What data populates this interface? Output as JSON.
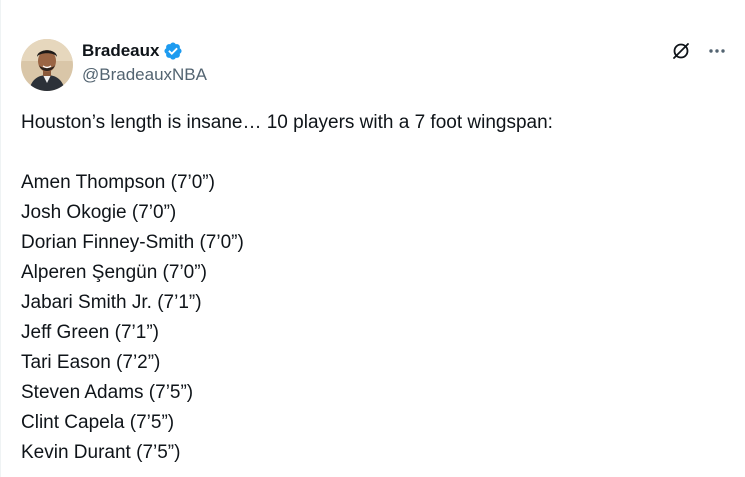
{
  "author": {
    "display_name": "Bradeaux",
    "handle": "@BradeauxNBA",
    "verified_badge_color": "#1d9bf0"
  },
  "actions": {
    "grok_icon": "grok-icon",
    "more_icon": "more-icon"
  },
  "tweet": {
    "intro": "Houston’s length is insane… 10 players with a 7 foot wingspan:",
    "players": [
      "Amen Thompson (7’0”)",
      "Josh Okogie (7’0”)",
      "Dorian Finney-Smith (7’0”)",
      "Alperen Şengün (7’0”)",
      "Jabari Smith Jr. (7’1”)",
      "Jeff Green (7’1”)",
      "Tari Eason (7’2”)",
      "Steven Adams (7’5”)",
      "Clint Capela (7’5”)",
      "Kevin Durant (7’5”)"
    ]
  }
}
